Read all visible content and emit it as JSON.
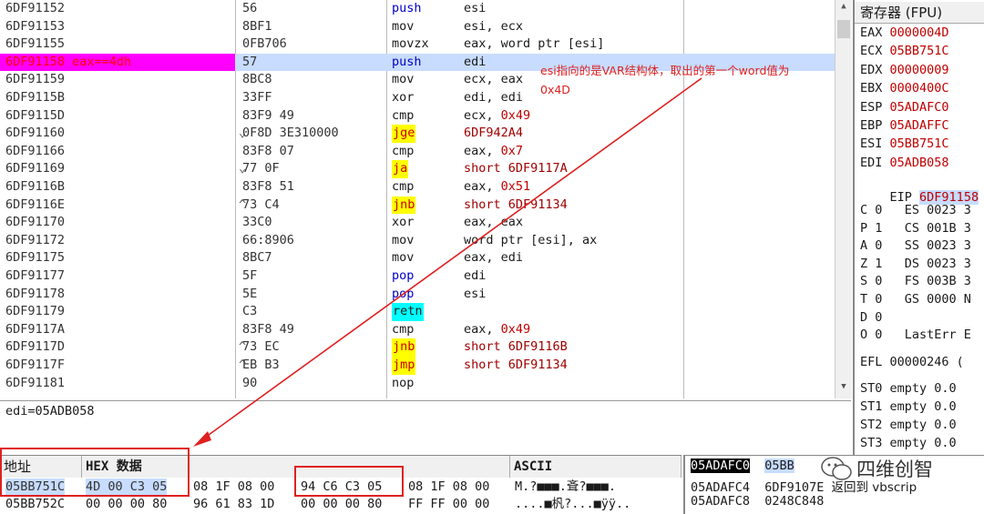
{
  "disasm_rows": [
    {
      "addr": "6DF91152",
      "hex": "56",
      "jm": "",
      "mn": "push",
      "mt": "blue",
      "op": "esi",
      "ot": "plain"
    },
    {
      "addr": "6DF91153",
      "hex": "8BF1",
      "jm": "",
      "mn": "mov",
      "mt": "plain",
      "op": "esi, ecx",
      "ot": "plain"
    },
    {
      "addr": "6DF91155",
      "hex": "0FB706",
      "jm": "",
      "mn": "movzx",
      "mt": "plain",
      "op": "eax, word ptr [esi]",
      "ot": "plain"
    },
    {
      "addr": "6DF91158",
      "hex": "57",
      "jm": "",
      "mn": "push",
      "mt": "blue",
      "op": "edi",
      "ot": "plain",
      "bp": true,
      "addr_comment": "eax==4dh"
    },
    {
      "addr": "6DF91159",
      "hex": "8BC8",
      "jm": "",
      "mn": "mov",
      "mt": "plain",
      "op": "ecx, eax",
      "ot": "plain"
    },
    {
      "addr": "6DF9115B",
      "hex": "33FF",
      "jm": "",
      "mn": "xor",
      "mt": "plain",
      "op": "edi, edi",
      "ot": "plain"
    },
    {
      "addr": "6DF9115D",
      "hex": "83F9 49",
      "jm": "",
      "mn": "cmp",
      "mt": "plain",
      "op": "ecx, ",
      "num": "0x49",
      "ot": "plain"
    },
    {
      "addr": "6DF91160",
      "hex": "0F8D 3E310000",
      "jm": "⌄",
      "mn": "jge",
      "mt": "jmp",
      "op": "6DF942A4",
      "ot": "red"
    },
    {
      "addr": "6DF91166",
      "hex": "83F8 07",
      "jm": "",
      "mn": "cmp",
      "mt": "plain",
      "op": "eax, ",
      "num": "0x7",
      "ot": "plain"
    },
    {
      "addr": "6DF91169",
      "hex": "77 0F",
      "jm": "⌄",
      "mn": "ja",
      "mt": "jmp",
      "op": "short 6DF9117A",
      "ot": "red"
    },
    {
      "addr": "6DF9116B",
      "hex": "83F8 51",
      "jm": "",
      "mn": "cmp",
      "mt": "plain",
      "op": "eax, ",
      "num": "0x51",
      "ot": "plain"
    },
    {
      "addr": "6DF9116E",
      "hex": "73 C4",
      "jm": "^",
      "mn": "jnb",
      "mt": "jmp",
      "op": "short 6DF91134",
      "ot": "red"
    },
    {
      "addr": "6DF91170",
      "hex": "33C0",
      "jm": "",
      "mn": "xor",
      "mt": "plain",
      "op": "eax, eax",
      "ot": "plain"
    },
    {
      "addr": "6DF91172",
      "hex": "66:8906",
      "jm": "",
      "mn": "mov",
      "mt": "plain",
      "op": "word ptr [esi], ax",
      "ot": "plain"
    },
    {
      "addr": "6DF91175",
      "hex": "8BC7",
      "jm": "",
      "mn": "mov",
      "mt": "plain",
      "op": "eax, edi",
      "ot": "plain"
    },
    {
      "addr": "6DF91177",
      "hex": "5F",
      "jm": "",
      "mn": "pop",
      "mt": "blue",
      "op": "edi",
      "ot": "plain"
    },
    {
      "addr": "6DF91178",
      "hex": "5E",
      "jm": "",
      "mn": "pop",
      "mt": "blue",
      "op": "esi",
      "ot": "plain"
    },
    {
      "addr": "6DF91179",
      "hex": "C3",
      "jm": "",
      "mn": "retn",
      "mt": "ret",
      "op": "",
      "ot": "plain"
    },
    {
      "addr": "6DF9117A",
      "hex": "83F8 49",
      "jm": "",
      "mn": "cmp",
      "mt": "plain",
      "op": "eax, ",
      "num": "0x49",
      "ot": "plain"
    },
    {
      "addr": "6DF9117D",
      "hex": "73 EC",
      "jm": "^",
      "mn": "jnb",
      "mt": "jmp",
      "op": "short 6DF9116B",
      "ot": "red"
    },
    {
      "addr": "6DF9117F",
      "hex": "EB B3",
      "jm": "^",
      "mn": "jmp",
      "mt": "jmp",
      "op": "short 6DF91134",
      "ot": "red"
    },
    {
      "addr": "6DF91181",
      "hex": "90",
      "jm": "",
      "mn": "nop",
      "mt": "plain",
      "op": "",
      "ot": "plain"
    }
  ],
  "info_line": "edi=05ADB058",
  "registers": {
    "title": "寄存器 (FPU)",
    "gp": [
      {
        "n": "EAX",
        "v": "0000004D"
      },
      {
        "n": "ECX",
        "v": "05BB751C"
      },
      {
        "n": "EDX",
        "v": "00000009"
      },
      {
        "n": "EBX",
        "v": "0000400C"
      },
      {
        "n": "ESP",
        "v": "05ADAFC0"
      },
      {
        "n": "EBP",
        "v": "05ADAFFC"
      },
      {
        "n": "ESI",
        "v": "05BB751C"
      },
      {
        "n": "EDI",
        "v": "05ADB058"
      }
    ],
    "eip_name": "EIP",
    "eip_val": "6DF91158",
    "eip_tail": "v",
    "flags": [
      "C 0   ES 0023 3",
      "P 1   CS 001B 3",
      "A 0   SS 0023 3",
      "Z 1   DS 0023 3",
      "S 0   FS 003B 3",
      "T 0   GS 0000 N",
      "D 0",
      "O 0   LastErr E"
    ],
    "efl": "EFL 00000246 (",
    "st": [
      "ST0 empty 0.0",
      "ST1 empty 0.0",
      "ST2 empty 0.0",
      "ST3 empty 0.0"
    ]
  },
  "dump": {
    "col_addr": "地址",
    "col_hex": "HEX 数据",
    "col_ascii": "ASCII",
    "rows": [
      {
        "addr": "05BB751C",
        "b1": "4D 00 C3 05",
        "b2": "08 1F 08 00",
        "b3": "94 C6 C3 05",
        "b4": "08 1F 08 00",
        "ascii": "M.?■■■.斊?■■■."
      },
      {
        "addr": "05BB752C",
        "b1": "00 00 00 80",
        "b2": "96 61 83 1D",
        "b3": "00 00 00 80",
        "b4": "FF FF 00 00",
        "ascii": "....■杋?...■ÿÿ.."
      }
    ]
  },
  "stack": {
    "rows": [
      {
        "a": "05ADAFC0",
        "v": "05BB",
        "c": ""
      },
      {
        "a": "05ADAFC4",
        "v": "6DF9107E",
        "c": "返回到 vbscrip"
      },
      {
        "a": "05ADAFC8",
        "v": "0248C848",
        "c": ""
      }
    ]
  },
  "annotations": {
    "note_line1": "esi指向的是VAR结构体，取出的第一个word值为",
    "note_line2": "0x4D",
    "color": "#e02020"
  },
  "watermark": "四维创智",
  "colors": {
    "breakpoint": "#ff00ff",
    "selection": "#c7dcff",
    "jump": "#ffff00",
    "ret": "#00ffff"
  }
}
